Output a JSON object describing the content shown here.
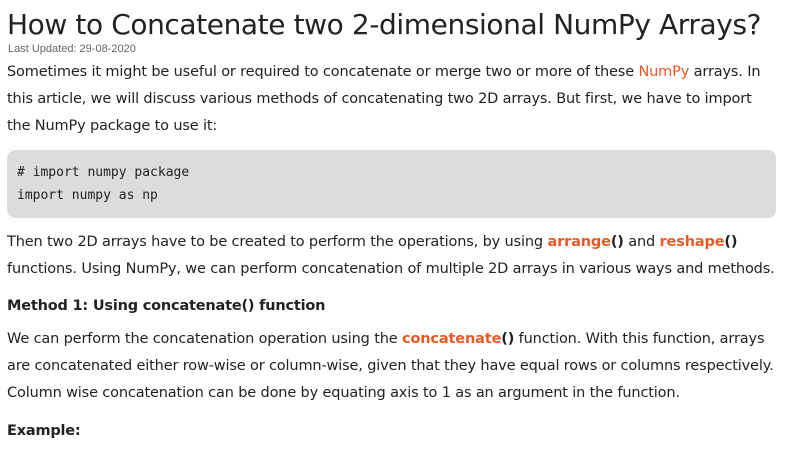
{
  "article": {
    "title": "How to Concatenate two 2-dimensional NumPy Arrays?",
    "last_updated": "Last Updated: 29-08-2020",
    "intro": {
      "text_before_link": "Sometimes it might be useful or required to concatenate or merge two or more of these ",
      "link_text": "NumPy",
      "text_after_link": " arrays. In this article, we will discuss various methods of concatenating two 2D arrays. But first, we have to import the NumPy package to use it:"
    },
    "code_block": {
      "lines": [
        "# import numpy package",
        "import numpy as np"
      ]
    },
    "para2": {
      "text1": "Then two 2D arrays have to be created to perform the operations, by using ",
      "fn1": "arrange",
      "fn1_paren": "()",
      "text2": " and ",
      "fn2": "reshape",
      "fn2_paren": "()",
      "text3": " functions. Using NumPy, we can perform concatenation of multiple 2D arrays in various ways and methods."
    },
    "method1_heading": "Method 1: Using concatenate() function",
    "para3": {
      "text1": "We can perform the concatenation operation using the ",
      "fn": "concatenate",
      "fn_paren": "()",
      "text2": " function. With this function, arrays are concatenated either row-wise or column-wise, given that they have equal rows or columns respectively. Column wise concatenation can be done by equating axis to 1 as an argument in the function."
    },
    "example_heading": "Example:"
  },
  "colors": {
    "accent": "#e85a24",
    "code_background": "#dcdcdc",
    "text": "#222222"
  }
}
